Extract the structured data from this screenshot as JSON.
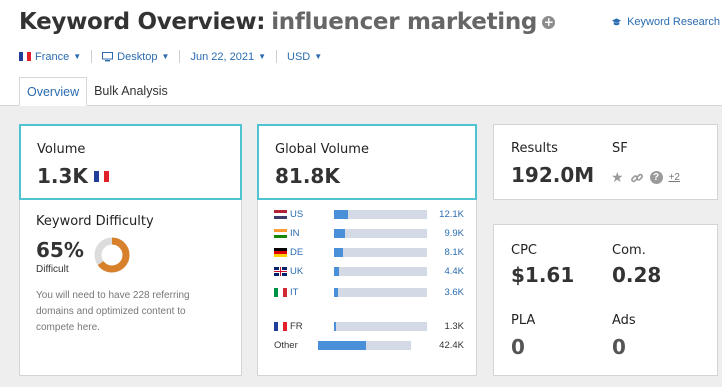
{
  "header": {
    "title": "Keyword Overview:",
    "keyword": "influencer marketing",
    "add_icon": "+",
    "keyword_research_link": "Keyword Research"
  },
  "filters": [
    {
      "label": "France",
      "icon": "france-flag"
    },
    {
      "label": "Desktop",
      "icon": "desktop-icon"
    },
    {
      "label": "Jun 22, 2021",
      "icon": ""
    },
    {
      "label": "USD",
      "icon": ""
    }
  ],
  "tabs": [
    {
      "label": "Overview",
      "active": true
    },
    {
      "label": "Bulk Analysis",
      "active": false
    }
  ],
  "volume": {
    "label": "Volume",
    "value": "1.3K"
  },
  "global_volume": {
    "label": "Global Volume",
    "value": "81.8K",
    "countries": [
      {
        "code": "US",
        "value": "12.1K",
        "share": 0.148
      },
      {
        "code": "IN",
        "value": "9.9K",
        "share": 0.121
      },
      {
        "code": "DE",
        "value": "8.1K",
        "share": 0.099
      },
      {
        "code": "UK",
        "value": "4.4K",
        "share": 0.054
      },
      {
        "code": "IT",
        "value": "3.6K",
        "share": 0.044
      }
    ],
    "france": {
      "code": "FR",
      "value": "1.3K",
      "share": 0.016
    },
    "other": {
      "code": "Other",
      "value": "42.4K",
      "share": 0.518
    }
  },
  "keyword_difficulty": {
    "label": "Keyword Difficulty",
    "value": "65%",
    "level": "Difficult",
    "percent": 65,
    "note": "You will need to have 228 referring domains and optimized content to compete here.",
    "color": "#d7812c"
  },
  "results": {
    "label": "Results",
    "value": "192.0M",
    "sf_label": "SF",
    "sf_more": "+2"
  },
  "metrics": {
    "cpc_label": "CPC",
    "cpc_value": "$1.61",
    "com_label": "Com.",
    "com_value": "0.28",
    "pla_label": "PLA",
    "pla_value": "0",
    "ads_label": "Ads",
    "ads_value": "0"
  },
  "colors": {
    "accent": "#2b6cb0",
    "highlight": "#4fc3d0",
    "bar": "#4a90d9"
  }
}
